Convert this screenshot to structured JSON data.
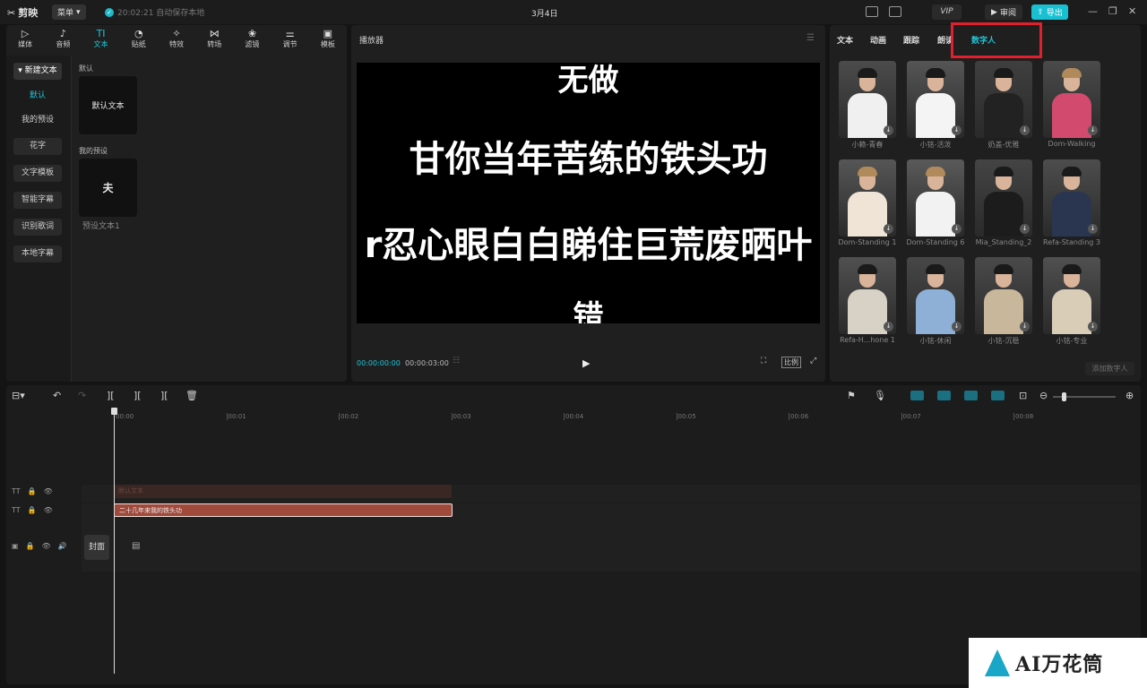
{
  "app": {
    "name": "剪映",
    "menu_label": "菜单",
    "autosave": "20:02:21 自动保存本地",
    "doc_title": "3月4日",
    "vip": "VIP",
    "review": "审阅",
    "export": "导出"
  },
  "library": {
    "tabs": [
      {
        "label": "媒体",
        "icon": "▷"
      },
      {
        "label": "音频",
        "icon": "♪"
      },
      {
        "label": "文本",
        "icon": "TI"
      },
      {
        "label": "贴纸",
        "icon": "◔"
      },
      {
        "label": "特效",
        "icon": "✧"
      },
      {
        "label": "转场",
        "icon": "⋈"
      },
      {
        "label": "滤镜",
        "icon": "❀"
      },
      {
        "label": "调节",
        "icon": "⚌"
      },
      {
        "label": "模板",
        "icon": "▣"
      }
    ],
    "side": [
      "▾ 新建文本",
      "默认",
      "我的预设",
      "花字",
      "文字模板",
      "智能字幕",
      "识别歌词",
      "本地字幕"
    ],
    "section_default": "默认",
    "card_default": "默认文本",
    "section_mine": "我的预设",
    "card_mine_glyph": "夫",
    "card_mine_caption": "预设文本1"
  },
  "player": {
    "title": "播放器",
    "lines": [
      "无做",
      "甘你当年苦练的铁头功",
      "r忍心眼白白睇住巨荒废晒叶",
      "错"
    ],
    "time_current": "00:00:00:00",
    "time_total": "00:00:03:00",
    "ratio": "比例"
  },
  "properties": {
    "tabs": [
      "文本",
      "动画",
      "跟踪",
      "朗读",
      "数字人"
    ],
    "avatars": [
      "小赖-青春",
      "小铭-活泼",
      "奶盖-优雅",
      "Dom-Walking",
      "Dom-Standing 1",
      "Dom-Standing 6",
      "Mia_Standing_2",
      "Refa-Standing 3",
      "Refa-H...hone 1",
      "小铭-休闲",
      "小铭-沉稳",
      "小铭-专业"
    ],
    "add_button": "添加数字人"
  },
  "timeline": {
    "ticks": [
      "00:00",
      "00:01",
      "00:02",
      "00:03",
      "00:04",
      "00:05",
      "00:06",
      "00:07",
      "00:08"
    ],
    "clip_ghost": "默认文本",
    "clip_main": "二十几年来我的铁头功",
    "cover": "封面"
  },
  "watermark": "AI万花筒"
}
